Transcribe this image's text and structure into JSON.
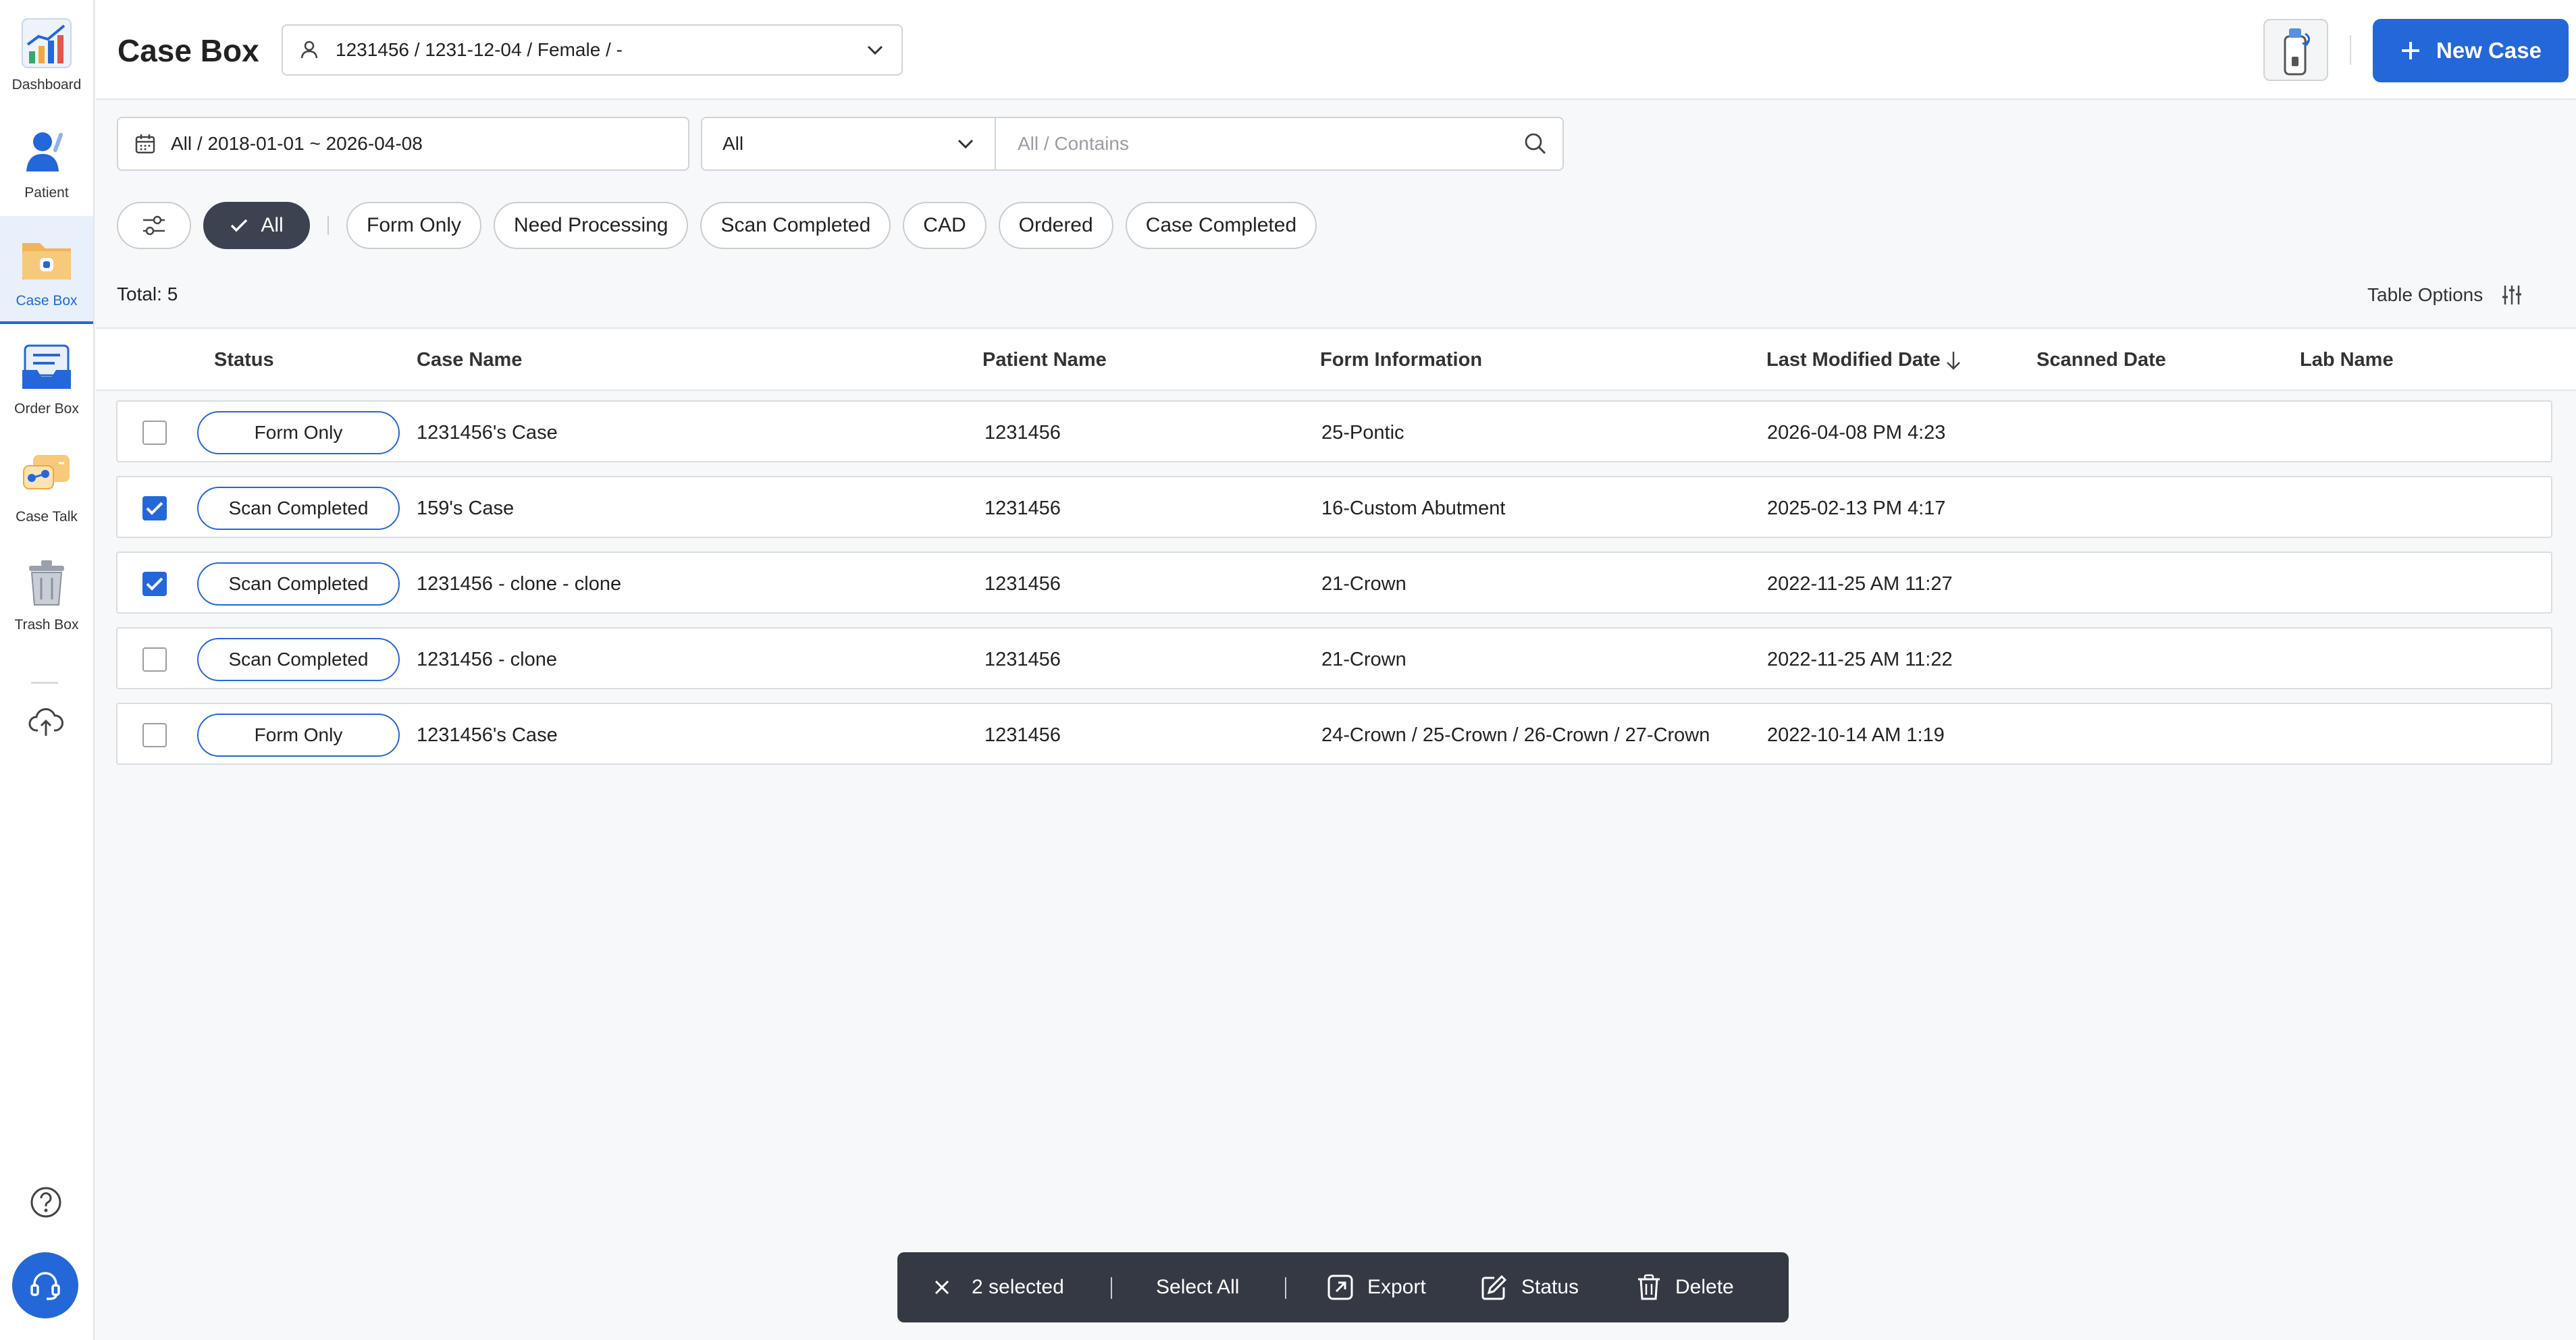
{
  "sidebar": {
    "items": [
      {
        "label": "Dashboard",
        "icon": "chart-icon"
      },
      {
        "label": "Patient",
        "icon": "person-icon"
      },
      {
        "label": "Case Box",
        "icon": "folder-icon"
      },
      {
        "label": "Order Box",
        "icon": "inbox-icon"
      },
      {
        "label": "Case Talk",
        "icon": "chat-icon"
      },
      {
        "label": "Trash Box",
        "icon": "trash-icon"
      }
    ]
  },
  "header": {
    "title": "Case Box",
    "patient": "1231456 / 1231-12-04 / Female / -",
    "new_case_label": "New Case"
  },
  "filters": {
    "date_range": "All / 2018-01-01 ~ 2026-04-08",
    "scope": "All",
    "search_placeholder": "All / Contains",
    "chips": {
      "all": "All",
      "form_only": "Form Only",
      "need_processing": "Need Processing",
      "scan_completed": "Scan Completed",
      "cad": "CAD",
      "ordered": "Ordered",
      "case_completed": "Case Completed"
    }
  },
  "summary": {
    "total": "Total: 5",
    "table_options": "Table Options"
  },
  "table": {
    "columns": {
      "status": "Status",
      "case_name": "Case Name",
      "patient_name": "Patient Name",
      "form_information": "Form Information",
      "last_modified": "Last Modified Date",
      "scanned_date": "Scanned Date",
      "lab_name": "Lab Name"
    },
    "rows": [
      {
        "checked": false,
        "status": "Form Only",
        "case_name": "1231456's Case",
        "patient_name": "1231456",
        "form_information": "25-Pontic",
        "last_modified": "2026-04-08 PM 4:23",
        "scanned_date": "",
        "lab_name": ""
      },
      {
        "checked": true,
        "status": "Scan Completed",
        "case_name": "159's Case",
        "patient_name": "1231456",
        "form_information": "16-Custom Abutment",
        "last_modified": "2025-02-13 PM 4:17",
        "scanned_date": "",
        "lab_name": ""
      },
      {
        "checked": true,
        "status": "Scan Completed",
        "case_name": "1231456 - clone - clone",
        "patient_name": "1231456",
        "form_information": "21-Crown",
        "last_modified": "2022-11-25 AM 11:27",
        "scanned_date": "",
        "lab_name": ""
      },
      {
        "checked": false,
        "status": "Scan Completed",
        "case_name": "1231456 - clone",
        "patient_name": "1231456",
        "form_information": "21-Crown",
        "last_modified": "2022-11-25 AM 11:22",
        "scanned_date": "",
        "lab_name": ""
      },
      {
        "checked": false,
        "status": "Form Only",
        "case_name": "1231456's Case",
        "patient_name": "1231456",
        "form_information": "24-Crown / 25-Crown / 26-Crown / 27-Crown",
        "last_modified": "2022-10-14 AM 1:19",
        "scanned_date": "",
        "lab_name": ""
      }
    ]
  },
  "action_bar": {
    "selected": "2 selected",
    "select_all": "Select All",
    "export": "Export",
    "status": "Status",
    "delete": "Delete"
  },
  "colors": {
    "accent": "#2467d8",
    "chip_active": "#3c4250",
    "action_bar": "#353943"
  }
}
